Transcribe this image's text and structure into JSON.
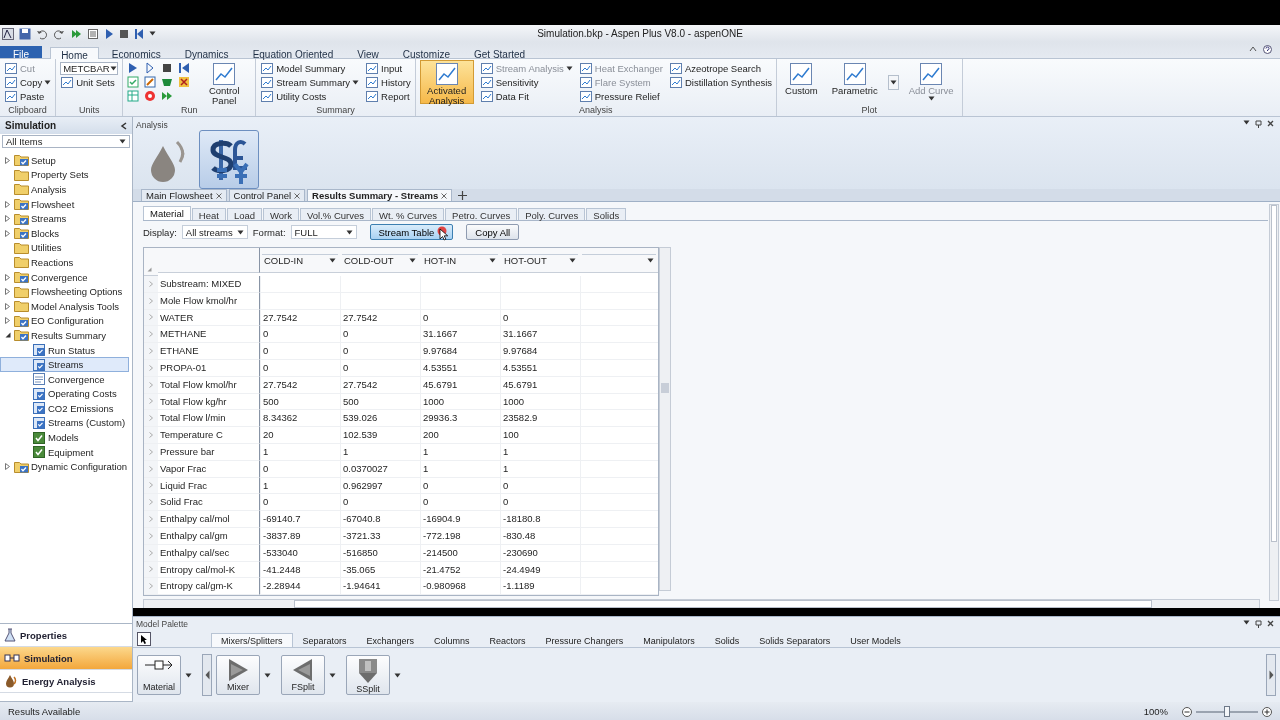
{
  "window": {
    "title": "Simulation.bkp - Aspen Plus V8.0 - aspenONE"
  },
  "ribbon_tabs": [
    {
      "label": "File",
      "kind": "file",
      "selected": false
    },
    {
      "label": "Home",
      "kind": "tab",
      "selected": true
    },
    {
      "label": "Economics",
      "kind": "tab",
      "selected": false
    },
    {
      "label": "Dynamics",
      "kind": "tab",
      "selected": false
    },
    {
      "label": "Equation Oriented",
      "kind": "tab",
      "selected": false
    },
    {
      "label": "View",
      "kind": "tab",
      "selected": false
    },
    {
      "label": "Customize",
      "kind": "tab",
      "selected": false
    },
    {
      "label": "Get Started",
      "kind": "tab",
      "selected": false
    }
  ],
  "ribbon_groups": [
    {
      "label": "Clipboard",
      "items": [
        {
          "kind": "small",
          "label": "Cut",
          "disabled": true
        },
        {
          "kind": "small",
          "label": "Copy",
          "disabled": false,
          "dropdown": true
        },
        {
          "kind": "small",
          "label": "Paste",
          "disabled": false
        }
      ]
    },
    {
      "label": "Units",
      "items": [
        {
          "kind": "select",
          "value": "METCBAR"
        },
        {
          "kind": "small",
          "label": "Unit Sets",
          "disabled": false
        }
      ]
    },
    {
      "label": "Run",
      "items": [
        {
          "kind": "run"
        },
        {
          "kind": "big",
          "label": "Control Panel",
          "disabled": false
        }
      ]
    },
    {
      "label": "Summary",
      "items": [
        {
          "kind": "small",
          "label": "Model Summary",
          "disabled": false
        },
        {
          "kind": "small",
          "label": "Stream Summary",
          "disabled": false,
          "dropdown": true
        },
        {
          "kind": "small",
          "label": "Utility Costs",
          "disabled": false
        },
        {
          "kind": "small",
          "label": "Input",
          "disabled": false
        },
        {
          "kind": "small",
          "label": "History",
          "disabled": false
        },
        {
          "kind": "small",
          "label": "Report",
          "disabled": false
        }
      ]
    },
    {
      "label": "Analysis",
      "items": [
        {
          "kind": "big",
          "label": "Activated Analysis",
          "disabled": false,
          "on": true
        },
        {
          "kind": "small",
          "label": "Stream Analysis",
          "disabled": true,
          "dropdown": true
        },
        {
          "kind": "small",
          "label": "Sensitivity",
          "disabled": false
        },
        {
          "kind": "small",
          "label": "Data Fit",
          "disabled": false
        },
        {
          "kind": "small",
          "label": "Heat Exchanger",
          "disabled": true
        },
        {
          "kind": "small",
          "label": "Flare System",
          "disabled": true
        },
        {
          "kind": "small",
          "label": "Pressure Relief",
          "disabled": false
        },
        {
          "kind": "small",
          "label": "Azeotrope Search",
          "disabled": false
        },
        {
          "kind": "small",
          "label": "Distillation Synthesis",
          "disabled": false
        }
      ]
    },
    {
      "label": "Plot",
      "items": [
        {
          "kind": "big",
          "label": "Custom",
          "disabled": false
        },
        {
          "kind": "big",
          "label": "Parametric",
          "disabled": false
        },
        {
          "kind": "more"
        },
        {
          "kind": "big",
          "label": "Add Curve",
          "disabled": true,
          "dropdown": true
        }
      ]
    }
  ],
  "sidebar": {
    "title": "Simulation",
    "filter": "All Items",
    "tree": [
      {
        "label": "Setup",
        "kind": "done-folder",
        "expanded": false,
        "selected": false
      },
      {
        "label": "Property Sets",
        "kind": "folder",
        "selected": false
      },
      {
        "label": "Analysis",
        "kind": "folder",
        "selected": false
      },
      {
        "label": "Flowsheet",
        "kind": "done-folder",
        "expanded": false,
        "selected": false
      },
      {
        "label": "Streams",
        "kind": "done-folder",
        "expanded": false,
        "selected": false
      },
      {
        "label": "Blocks",
        "kind": "done-folder",
        "expanded": false,
        "selected": false
      },
      {
        "label": "Utilities",
        "kind": "folder",
        "selected": false
      },
      {
        "label": "Reactions",
        "kind": "folder",
        "selected": false
      },
      {
        "label": "Convergence",
        "kind": "done-folder",
        "expanded": false,
        "selected": false
      },
      {
        "label": "Flowsheeting Options",
        "kind": "folder",
        "expanded": false,
        "selected": false
      },
      {
        "label": "Model Analysis Tools",
        "kind": "folder",
        "expanded": false,
        "selected": false
      },
      {
        "label": "EO Configuration",
        "kind": "done-folder",
        "expanded": false,
        "selected": false
      },
      {
        "label": "Results Summary",
        "kind": "done-folder",
        "expanded": true,
        "selected": false,
        "children": [
          {
            "label": "Run Status",
            "kind": "done-form",
            "selected": false
          },
          {
            "label": "Streams",
            "kind": "done-form",
            "selected": true
          },
          {
            "label": "Convergence",
            "kind": "form",
            "selected": false
          },
          {
            "label": "Operating Costs",
            "kind": "done-form",
            "selected": false
          },
          {
            "label": "CO2 Emissions",
            "kind": "done-form",
            "selected": false
          },
          {
            "label": "Streams (Custom)",
            "kind": "done-form",
            "selected": false
          },
          {
            "label": "Models",
            "kind": "model",
            "selected": false
          },
          {
            "label": "Equipment",
            "kind": "model",
            "selected": false
          }
        ]
      },
      {
        "label": "Dynamic Configuration",
        "kind": "done-folder",
        "expanded": false,
        "selected": false
      }
    ],
    "nav_buttons": [
      {
        "label": "Properties",
        "kind": "properties",
        "selected": false
      },
      {
        "label": "Simulation",
        "kind": "simulation",
        "selected": true
      },
      {
        "label": "Energy Analysis",
        "kind": "energy",
        "selected": false
      }
    ]
  },
  "analysis_panel": {
    "title": "Analysis",
    "tools": [
      {
        "kind": "energy",
        "selected": false
      },
      {
        "kind": "economics",
        "selected": true
      }
    ]
  },
  "document_tabs": [
    {
      "label": "Main Flowsheet",
      "selected": false
    },
    {
      "label": "Control Panel",
      "selected": false
    },
    {
      "label": "Results Summary - Streams",
      "selected": true
    }
  ],
  "sheet_tabs": [
    {
      "label": "Material",
      "selected": true
    },
    {
      "label": "Heat",
      "selected": false
    },
    {
      "label": "Load",
      "selected": false
    },
    {
      "label": "Work",
      "selected": false
    },
    {
      "label": "Vol.% Curves",
      "selected": false
    },
    {
      "label": "Wt. % Curves",
      "selected": false
    },
    {
      "label": "Petro. Curves",
      "selected": false
    },
    {
      "label": "Poly. Curves",
      "selected": false
    },
    {
      "label": "Solids",
      "selected": false
    }
  ],
  "toolbar": {
    "display_label": "Display:",
    "display_value": "All streams",
    "format_label": "Format:",
    "format_value": "FULL",
    "buttons": [
      {
        "label": "Stream Table",
        "pressed": true
      },
      {
        "label": "Copy All",
        "pressed": false
      }
    ]
  },
  "table": {
    "columns": [
      "COLD-IN",
      "COLD-OUT",
      "HOT-IN",
      "HOT-OUT"
    ],
    "rows": [
      {
        "label": "Substream: MIXED"
      },
      {
        "label": "Mole Flow kmol/hr"
      },
      {
        "label": "WATER",
        "values": [
          "27.7542",
          "27.7542",
          "0",
          "0"
        ]
      },
      {
        "label": "METHANE",
        "values": [
          "0",
          "0",
          "31.1667",
          "31.1667"
        ]
      },
      {
        "label": "ETHANE",
        "values": [
          "0",
          "0",
          "9.97684",
          "9.97684"
        ]
      },
      {
        "label": "PROPA-01",
        "values": [
          "0",
          "0",
          "4.53551",
          "4.53551"
        ]
      },
      {
        "label": "Total Flow kmol/hr",
        "values": [
          "27.7542",
          "27.7542",
          "45.6791",
          "45.6791"
        ]
      },
      {
        "label": "Total Flow kg/hr",
        "values": [
          "500",
          "500",
          "1000",
          "1000"
        ]
      },
      {
        "label": "Total Flow l/min",
        "values": [
          "8.34362",
          "539.026",
          "29936.3",
          "23582.9"
        ]
      },
      {
        "label": "Temperature C",
        "values": [
          "20",
          "102.539",
          "200",
          "100"
        ]
      },
      {
        "label": "Pressure bar",
        "values": [
          "1",
          "1",
          "1",
          "1"
        ]
      },
      {
        "label": "Vapor Frac",
        "values": [
          "0",
          "0.0370027",
          "1",
          "1"
        ]
      },
      {
        "label": "Liquid Frac",
        "values": [
          "1",
          "0.962997",
          "0",
          "0"
        ]
      },
      {
        "label": "Solid Frac",
        "values": [
          "0",
          "0",
          "0",
          "0"
        ]
      },
      {
        "label": "Enthalpy cal/mol",
        "values": [
          "-69140.7",
          "-67040.8",
          "-16904.9",
          "-18180.8"
        ]
      },
      {
        "label": "Enthalpy cal/gm",
        "values": [
          "-3837.89",
          "-3721.33",
          "-772.198",
          "-830.48"
        ]
      },
      {
        "label": "Enthalpy cal/sec",
        "values": [
          "-533040",
          "-516850",
          "-214500",
          "-230690"
        ]
      },
      {
        "label": "Entropy cal/mol-K",
        "values": [
          "-41.2448",
          "-35.065",
          "-21.4752",
          "-24.4949"
        ]
      },
      {
        "label": "Entropy cal/gm-K",
        "values": [
          "-2.28944",
          "-1.94641",
          "-0.980968",
          "-1.1189"
        ]
      }
    ]
  },
  "model_palette": {
    "title": "Model Palette",
    "tabs": [
      {
        "label": "Mixers/Splitters",
        "selected": true
      },
      {
        "label": "Separators",
        "selected": false
      },
      {
        "label": "Exchangers",
        "selected": false
      },
      {
        "label": "Columns",
        "selected": false
      },
      {
        "label": "Reactors",
        "selected": false
      },
      {
        "label": "Pressure Changers",
        "selected": false
      },
      {
        "label": "Manipulators",
        "selected": false
      },
      {
        "label": "Solids",
        "selected": false
      },
      {
        "label": "Solids Separators",
        "selected": false
      },
      {
        "label": "User Models",
        "selected": false
      }
    ],
    "models": [
      {
        "label": "Material",
        "kind": "stream"
      },
      {
        "label": "Mixer",
        "kind": "mixer"
      },
      {
        "label": "FSplit",
        "kind": "fsplit"
      },
      {
        "label": "SSplit",
        "kind": "ssplit"
      }
    ]
  },
  "status_bar": {
    "message": "Results Available",
    "zoom": "100%",
    "zoom_slider": {
      "level": 0.5
    }
  }
}
